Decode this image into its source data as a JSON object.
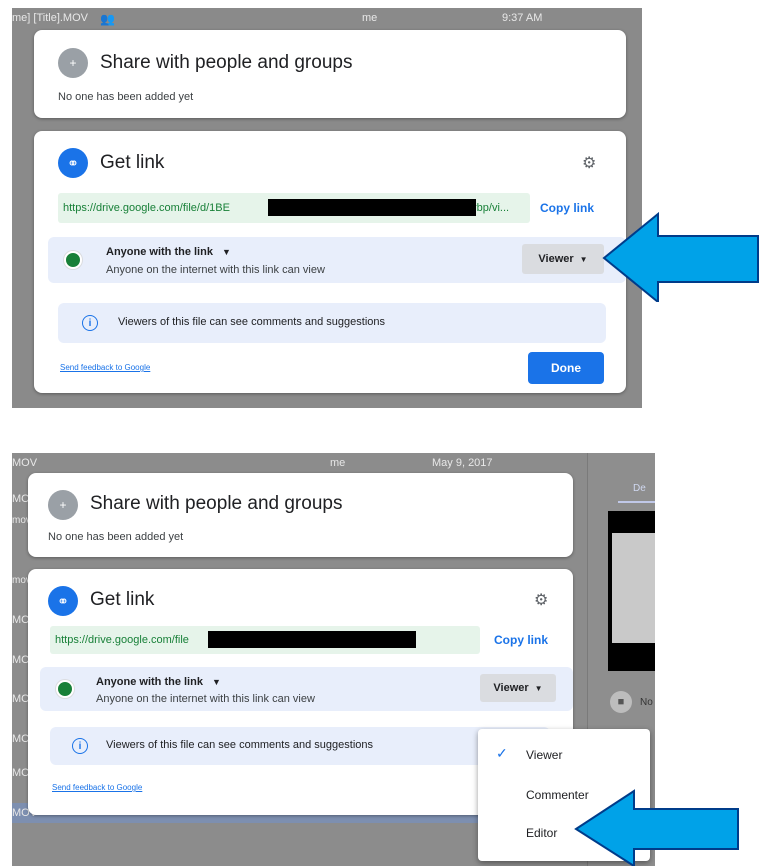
{
  "top": {
    "bg_row": {
      "name": "me] [Title].MOV",
      "owner": "me",
      "time": "9:37 AM"
    },
    "share": {
      "title": "Share with people and groups",
      "subtitle": "No one has been added yet"
    },
    "link": {
      "title": "Get link",
      "url_start": "https://drive.google.com/file/d/1BE",
      "url_end": "rbp/vi...",
      "copy_label": "Copy link",
      "access_title": "Anyone with the link",
      "access_desc": "Anyone on the internet with this link can view",
      "role": "Viewer",
      "info": "Viewers of this file can see comments and suggestions",
      "feedback": "Send feedback to Google",
      "done": "Done"
    }
  },
  "bottom": {
    "bg_row": {
      "name": "MOV",
      "owner": "me",
      "time": "May 9, 2017"
    },
    "side_labels": [
      "MOV",
      "MOV",
      "mov",
      "mov",
      "MOV",
      "MOV",
      "MOV",
      "MOV",
      "MOV",
      "MOV"
    ],
    "side_tab": "De",
    "side_lock_text": "No",
    "share": {
      "title": "Share with people and groups",
      "subtitle": "No one has been added yet"
    },
    "link": {
      "title": "Get link",
      "url_start": "https://drive.google.com/file",
      "copy_label": "Copy link",
      "access_title": "Anyone with the link",
      "access_desc": "Anyone on the internet with this link can view",
      "role": "Viewer",
      "info": "Viewers of this file can see comments and suggestions",
      "feedback": "Send feedback to Google"
    },
    "menu": {
      "items": [
        "Viewer",
        "Commenter",
        "Editor"
      ],
      "selected": "Viewer"
    }
  },
  "icons": {
    "share": "person-add-icon",
    "link": "link-icon",
    "settings": "gear-icon",
    "globe": "globe-icon",
    "info": "info-icon",
    "check": "check-icon",
    "caret": "caret-down-icon"
  },
  "colors": {
    "accent": "#1a73e8",
    "arrow": "#00a2e8",
    "url_bg": "#e6f4ea",
    "url_text": "#188038",
    "row_bg": "#e8eefb"
  }
}
